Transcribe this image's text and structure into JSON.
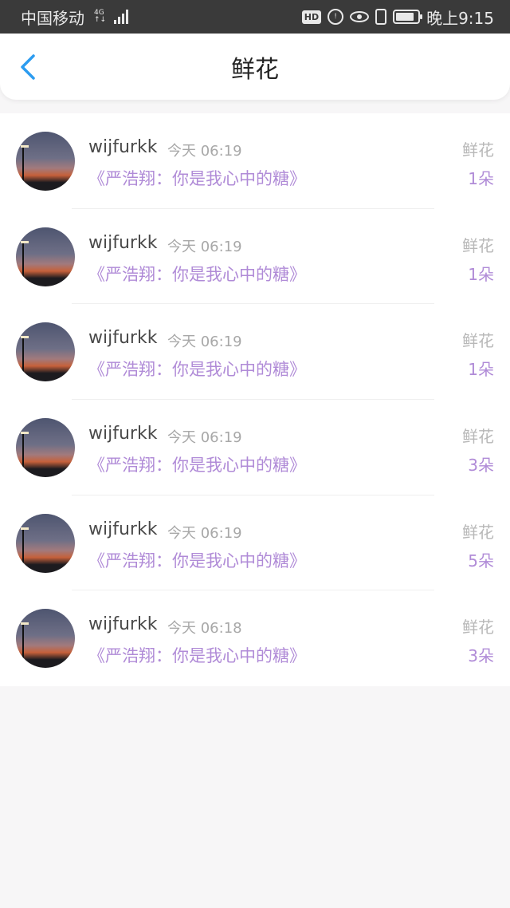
{
  "status_bar": {
    "carrier": "中国移动",
    "network_top": "4G",
    "network_bottom": "↑↓",
    "hd": "HD",
    "circle_icon_text": "!",
    "time": "晚上9:15"
  },
  "header": {
    "title": "鲜花"
  },
  "items": [
    {
      "username": "wijfurkk",
      "time": "今天 06:19",
      "book": "《严浩翔：你是我心中的糖》",
      "gift_label": "鲜花",
      "gift_count": "1朵"
    },
    {
      "username": "wijfurkk",
      "time": "今天 06:19",
      "book": "《严浩翔：你是我心中的糖》",
      "gift_label": "鲜花",
      "gift_count": "1朵"
    },
    {
      "username": "wijfurkk",
      "time": "今天 06:19",
      "book": "《严浩翔：你是我心中的糖》",
      "gift_label": "鲜花",
      "gift_count": "1朵"
    },
    {
      "username": "wijfurkk",
      "time": "今天 06:19",
      "book": "《严浩翔：你是我心中的糖》",
      "gift_label": "鲜花",
      "gift_count": "3朵"
    },
    {
      "username": "wijfurkk",
      "time": "今天 06:19",
      "book": "《严浩翔：你是我心中的糖》",
      "gift_label": "鲜花",
      "gift_count": "5朵"
    },
    {
      "username": "wijfurkk",
      "time": "今天 06:18",
      "book": "《严浩翔：你是我心中的糖》",
      "gift_label": "鲜花",
      "gift_count": "3朵"
    }
  ],
  "colors": {
    "accent": "#b08bd7",
    "back_arrow": "#2c9cf0"
  },
  "icons": {
    "back": "chevron-left-icon",
    "avatar": "sunset-avatar"
  }
}
